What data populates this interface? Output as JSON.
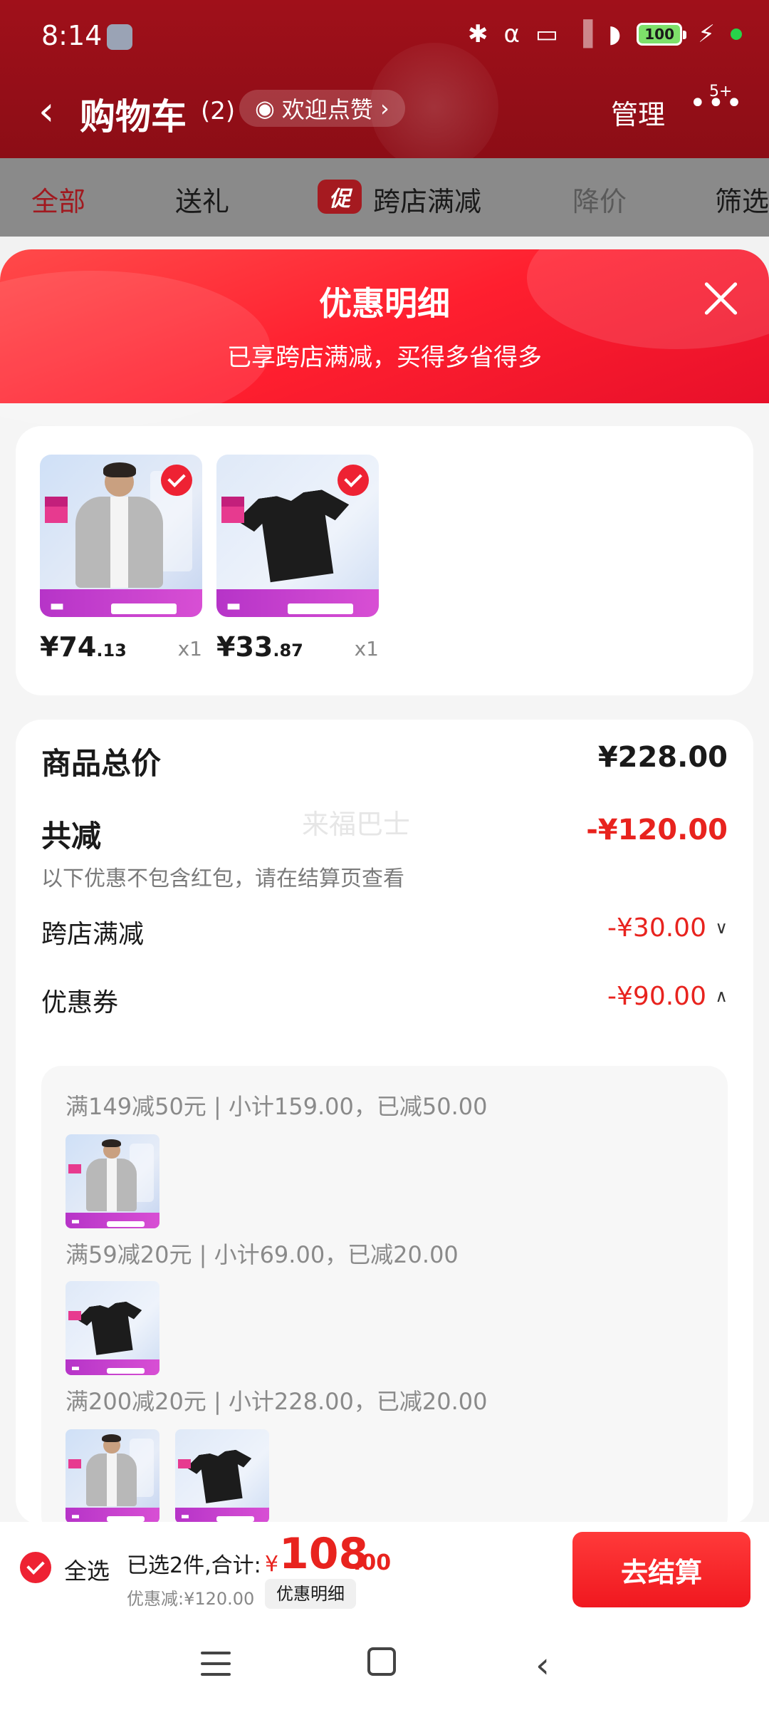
{
  "status_bar": {
    "time": "8:14",
    "battery": "100"
  },
  "header": {
    "title": "购物车",
    "count": "(2)",
    "like_label": "欢迎点赞",
    "manage_label": "管理",
    "badge": "5+"
  },
  "tabs": [
    {
      "label": "全部"
    },
    {
      "label": "送礼"
    },
    {
      "label": "跨店满减",
      "tag": "促"
    },
    {
      "label": "降价"
    },
    {
      "label": "筛选"
    }
  ],
  "modal": {
    "title": "优惠明细",
    "subtitle": "已享跨店满减，买得多省得多"
  },
  "goods": [
    {
      "price_int": "¥74",
      "price_dec": ".13",
      "qty": "x1",
      "icon": "jacket"
    },
    {
      "price_int": "¥33",
      "price_dec": ".87",
      "qty": "x1",
      "icon": "tshirt"
    }
  ],
  "summary": {
    "total_label": "商品总价",
    "total_amount": "¥228.00",
    "discount_label": "共减",
    "discount_amount": "-¥120.00",
    "note": "以下优惠不包含红包，请在结算页查看",
    "cross_store_label": "跨店满减",
    "cross_store_amount": "-¥30.00",
    "coupon_label": "优惠券",
    "coupon_amount": "-¥90.00",
    "watermark": "来福巴士"
  },
  "coupon_groups": [
    {
      "text": "满149减50元 | 小计159.00，已减50.00"
    },
    {
      "text": "满59减20元 | 小计69.00，已减20.00"
    },
    {
      "text": "满200减20元 | 小计228.00，已减20.00"
    }
  ],
  "bottom_bar": {
    "select_all": "全选",
    "summary_label": "已选2件,合计:",
    "currency": "¥",
    "total_int": "108",
    "total_dec": ".00",
    "discount_label": "优惠减:¥120.00",
    "detail_button": "优惠明细",
    "checkout_label": "去结算"
  },
  "colors": {
    "accent": "#e8231e",
    "header_dim": "#a0101a"
  }
}
